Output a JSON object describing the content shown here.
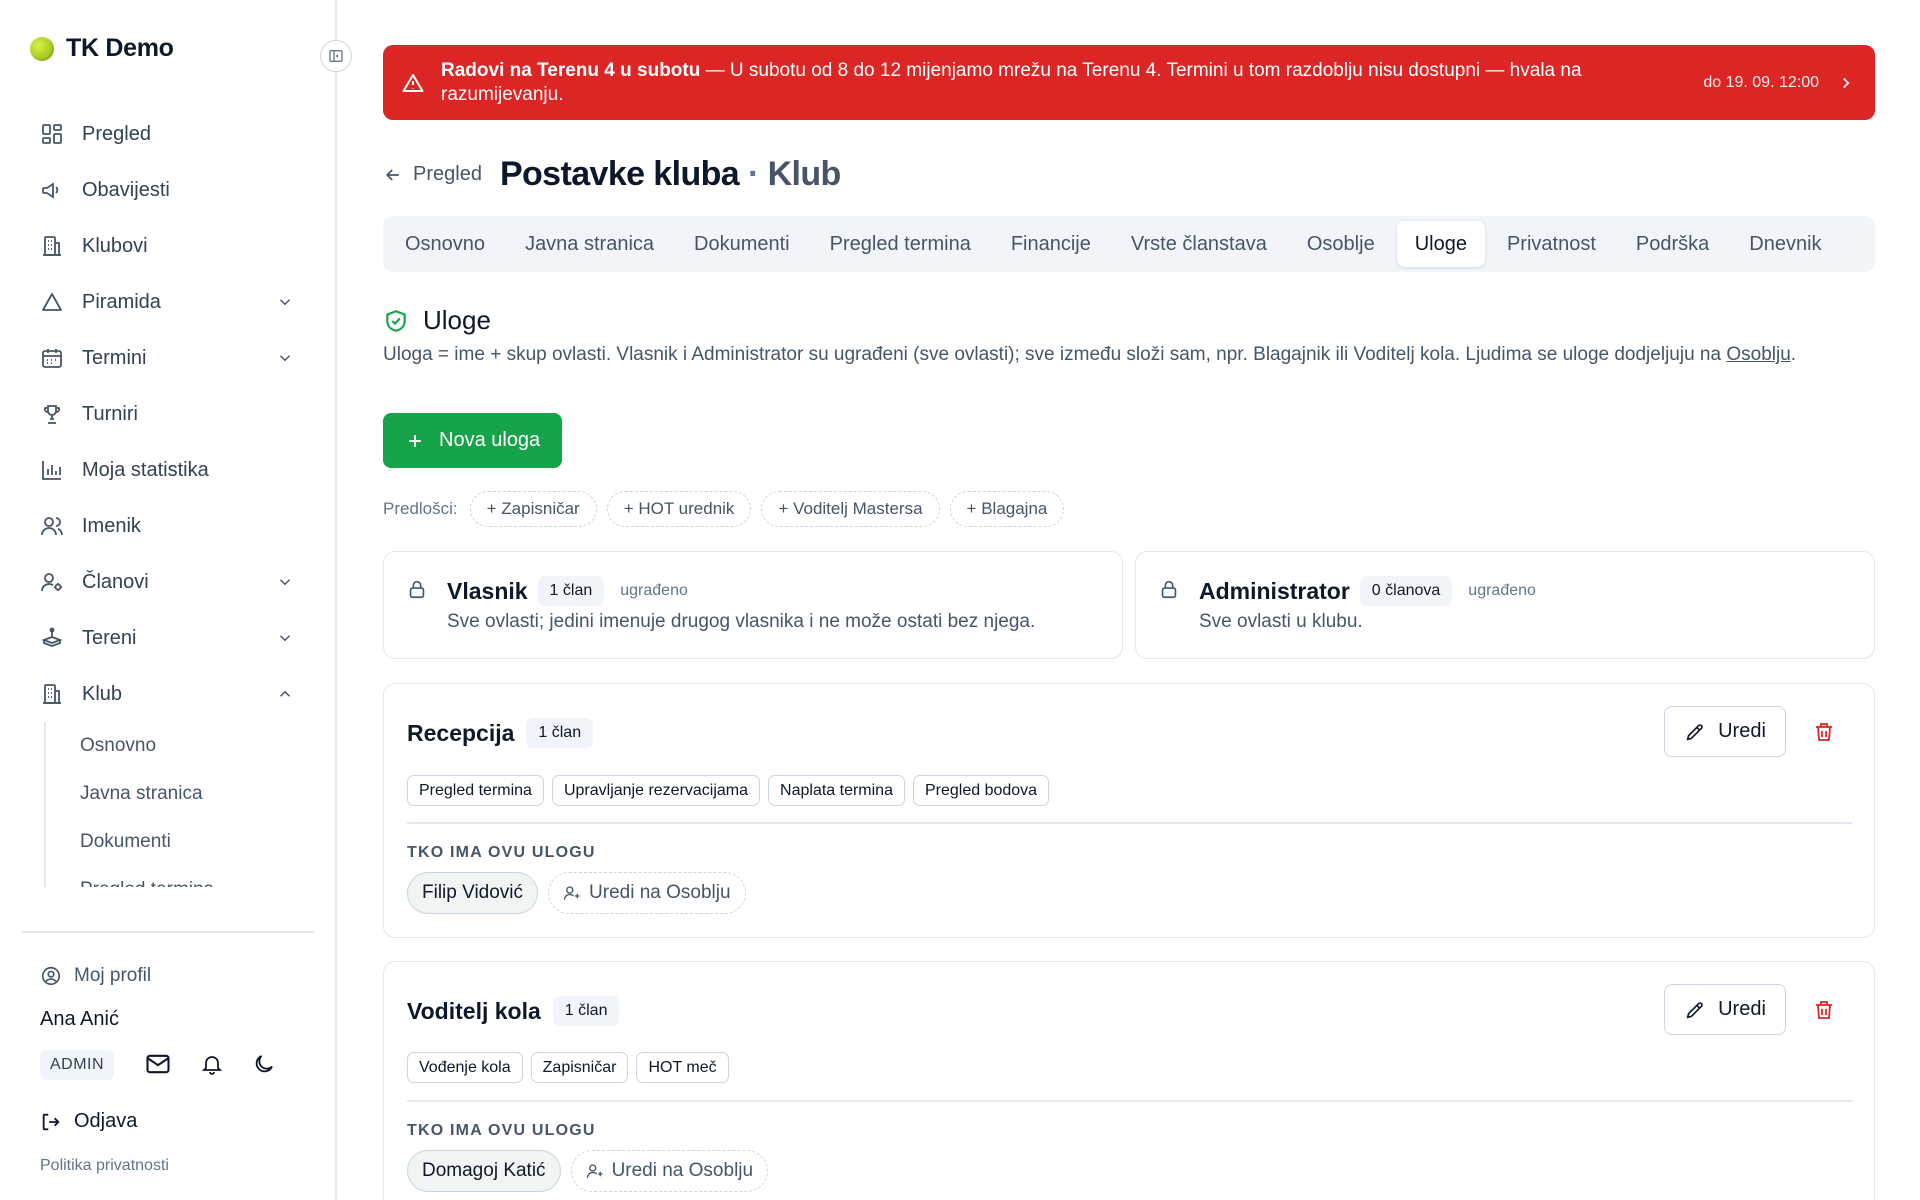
{
  "brand": {
    "name": "TK Demo"
  },
  "sidebar": {
    "items": [
      {
        "label": "Pregled",
        "icon": "dashboard-icon"
      },
      {
        "label": "Obavijesti",
        "icon": "megaphone-icon"
      },
      {
        "label": "Klubovi",
        "icon": "building-icon"
      },
      {
        "label": "Piramida",
        "icon": "triangle-icon",
        "expandable": true
      },
      {
        "label": "Termini",
        "icon": "calendar-icon",
        "expandable": true
      },
      {
        "label": "Turniri",
        "icon": "trophy-icon"
      },
      {
        "label": "Moja statistika",
        "icon": "bar-chart-icon"
      },
      {
        "label": "Imenik",
        "icon": "users-icon"
      },
      {
        "label": "Članovi",
        "icon": "user-cog-icon",
        "expandable": true
      },
      {
        "label": "Tereni",
        "icon": "court-icon",
        "expandable": true
      },
      {
        "label": "Klub",
        "icon": "building-icon",
        "expandable": true,
        "expanded": true
      }
    ],
    "klub_sub": [
      "Osnovno",
      "Javna stranica",
      "Dokumenti",
      "Pregled termina"
    ],
    "profile_link": "Moj profil",
    "user_name": "Ana Anić",
    "role_badge": "ADMIN",
    "logout": "Odjava",
    "privacy": "Politika privatnosti"
  },
  "alert": {
    "title": "Radovi na Terenu 4 u subotu",
    "message": " — U subotu od 8 do 12 mijenjamo mrežu na Terenu 4. Termini u tom razdoblju nisu dostupni — hvala na razumijevanju.",
    "until": "do 19. 09. 12:00",
    "color": "#dc2626"
  },
  "header": {
    "back_label": "Pregled",
    "title": "Postavke kluba",
    "separator": "·",
    "subtitle": "Klub"
  },
  "tabs": [
    {
      "label": "Osnovno"
    },
    {
      "label": "Javna stranica"
    },
    {
      "label": "Dokumenti"
    },
    {
      "label": "Pregled termina"
    },
    {
      "label": "Financije"
    },
    {
      "label": "Vrste članstava"
    },
    {
      "label": "Osoblje"
    },
    {
      "label": "Uloge",
      "active": true
    },
    {
      "label": "Privatnost"
    },
    {
      "label": "Podrška"
    },
    {
      "label": "Dnevnik"
    }
  ],
  "section": {
    "title": "Uloge",
    "description_prefix": "Uloga = ime + skup ovlasti. Vlasnik i Administrator su ugrađeni (sve ovlasti); sve između složi sam, npr. Blagajnik ili Voditelj kola. Ljudima se uloge dodjeljuju na ",
    "description_link": "Osoblju",
    "description_suffix": ".",
    "new_role_label": "Nova uloga",
    "accent": "#16a34a"
  },
  "templates": {
    "label": "Predlošci:",
    "items": [
      "+ Zapisničar",
      "+ HOT urednik",
      "+ Voditelj Mastersa",
      "+ Blagajna"
    ]
  },
  "builtin_roles": [
    {
      "name": "Vlasnik",
      "count": "1 član",
      "tag": "ugrađeno",
      "description": "Sve ovlasti; jedini imenuje drugog vlasnika i ne može ostati bez njega."
    },
    {
      "name": "Administrator",
      "count": "0 članova",
      "tag": "ugrađeno",
      "description": "Sve ovlasti u klubu."
    }
  ],
  "roles": [
    {
      "name": "Recepcija",
      "count": "1 član",
      "edit_label": "Uredi",
      "permissions": [
        "Pregled termina",
        "Upravljanje rezervacijama",
        "Naplata termina",
        "Pregled bodova"
      ],
      "who_label": "TKO IMA OVU ULOGU",
      "members": [
        "Filip Vidović"
      ],
      "edit_staff_label": "Uredi na Osoblju"
    },
    {
      "name": "Voditelj kola",
      "count": "1 član",
      "edit_label": "Uredi",
      "permissions": [
        "Vođenje kola",
        "Zapisničar",
        "HOT meč"
      ],
      "who_label": "TKO IMA OVU ULOGU",
      "members": [
        "Domagoj Katić"
      ],
      "edit_staff_label": "Uredi na Osoblju"
    }
  ]
}
